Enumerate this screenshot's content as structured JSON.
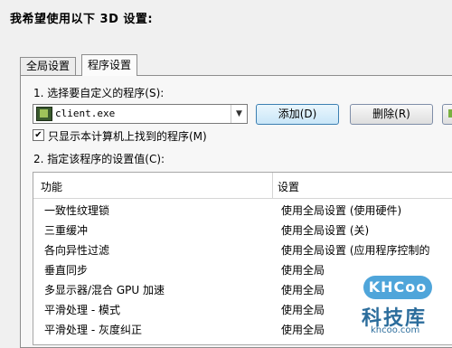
{
  "heading": "我希望使用以下 3D 设置:",
  "tabs": [
    {
      "label": "全局设置"
    },
    {
      "label": "程序设置"
    }
  ],
  "step1": {
    "label": "1. 选择要自定义的程序(S):",
    "selected_program": "client.exe",
    "add_button": "添加(D)",
    "delete_button": "删除(R)"
  },
  "checkbox": {
    "label": "只显示本计算机上找到的程序(M)",
    "checked": true
  },
  "step2": {
    "label": "2. 指定该程序的设置值(C):"
  },
  "grid": {
    "columns": [
      "功能",
      "设置"
    ],
    "rows": [
      {
        "feature": "一致性纹理锁",
        "setting": "使用全局设置 (使用硬件)"
      },
      {
        "feature": "三重缓冲",
        "setting": "使用全局设置 (关)"
      },
      {
        "feature": "各向异性过滤",
        "setting": "使用全局设置 (应用程序控制的"
      },
      {
        "feature": "垂直同步",
        "setting": "使用全局"
      },
      {
        "feature": "多显示器/混合 GPU 加速",
        "setting": "使用全局"
      },
      {
        "feature": "平滑处理 - 模式",
        "setting": "使用全局"
      },
      {
        "feature": "平滑处理 - 灰度纠正",
        "setting": "使用全局"
      }
    ]
  },
  "watermark": {
    "brand": "KHCoo",
    "title": "科技库",
    "url": "khcoo.com"
  },
  "colors": {
    "add_button_border": "#3c7fb1",
    "watermark_blue": "#4fa5da"
  }
}
